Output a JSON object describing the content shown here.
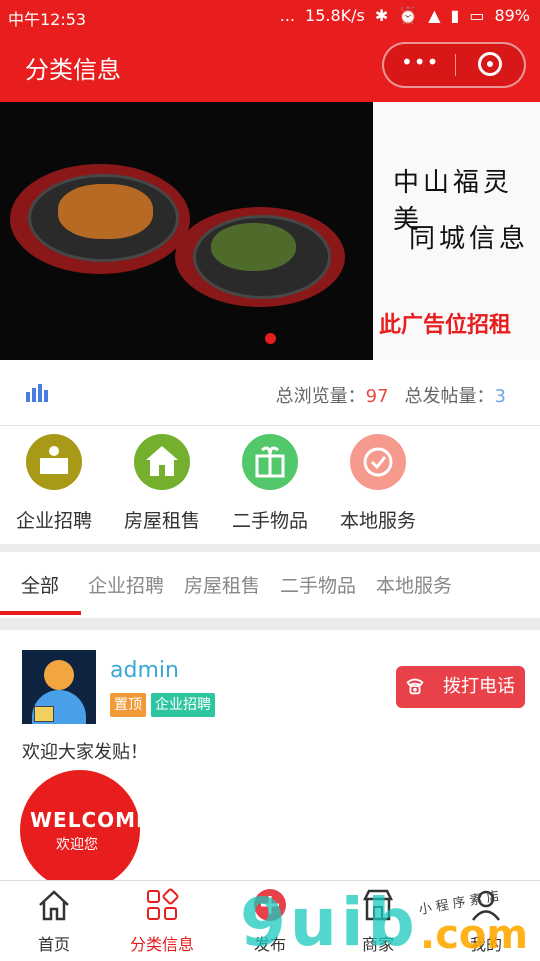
{
  "status_bar": {
    "time": "中午12:53",
    "speed": "15.8K/s",
    "battery": "89%",
    "dots": "..."
  },
  "header": {
    "title": "分类信息",
    "menu_dots": "•••"
  },
  "banner": {
    "ad_line1": "中山福灵美",
    "ad_line2": "同城信息",
    "ad_line3": "此广告位招租"
  },
  "stats": {
    "views_label": "总浏览量：",
    "views": "97",
    "posts_label": "总发帖量：",
    "posts": "3"
  },
  "categories": [
    {
      "label": "企业招聘",
      "color": "#a89a16"
    },
    {
      "label": "房屋租售",
      "color": "#74b02e"
    },
    {
      "label": "二手物品",
      "color": "#52c86a"
    },
    {
      "label": "本地服务",
      "color": "#f59a8c"
    }
  ],
  "tabs": [
    "全部",
    "企业招聘",
    "房屋租售",
    "二手物品",
    "本地服务"
  ],
  "post": {
    "username": "admin",
    "tag_top": "置顶",
    "tag_cat": "企业招聘",
    "call_label": "拨打电话",
    "content": "欢迎大家发贴！",
    "welcome_en": "WELCOME",
    "welcome_cn": "欢迎您"
  },
  "tabbar": [
    {
      "label": "首页",
      "icon": "home-icon"
    },
    {
      "label": "分类信息",
      "icon": "grid-icon"
    },
    {
      "label": "发布",
      "icon": "plus-icon"
    },
    {
      "label": "商家",
      "icon": "store-icon"
    },
    {
      "label": "我的",
      "icon": "user-icon"
    }
  ],
  "watermark": {
    "main": "9uib",
    "suffix": ".com",
    "script": "小 程 序 素 店"
  },
  "colors": {
    "brand_red": "#e81e1e",
    "link_blue": "#3aa8d8"
  }
}
